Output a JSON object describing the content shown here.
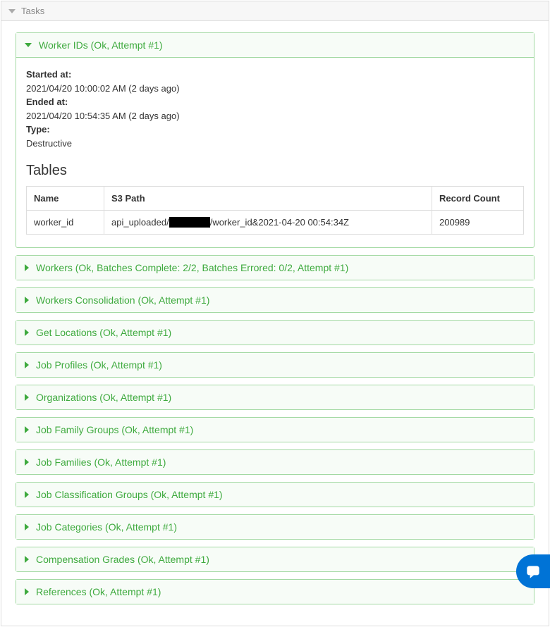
{
  "outer": {
    "title": "Tasks"
  },
  "expanded": {
    "title": "Worker IDs (Ok, Attempt #1)",
    "started_label": "Started at:",
    "started_val": "2021/04/20 10:00:02 AM (2 days ago)",
    "ended_label": "Ended at:",
    "ended_val": "2021/04/20 10:54:35 AM (2 days ago)",
    "type_label": "Type:",
    "type_val": "Destructive",
    "tables_heading": "Tables",
    "cols": {
      "name": "Name",
      "s3": "S3 Path",
      "count": "Record Count"
    },
    "row": {
      "name": "worker_id",
      "s3_pre": "api_uploaded/",
      "s3_post": "/worker_id&2021-04-20 00:54:34Z",
      "count": "200989"
    }
  },
  "tasks": [
    {
      "title": "Workers (Ok, Batches Complete: 2/2, Batches Errored: 0/2, Attempt #1)"
    },
    {
      "title": "Workers Consolidation (Ok, Attempt #1)"
    },
    {
      "title": "Get Locations (Ok, Attempt #1)"
    },
    {
      "title": "Job Profiles (Ok, Attempt #1)"
    },
    {
      "title": "Organizations (Ok, Attempt #1)"
    },
    {
      "title": "Job Family Groups (Ok, Attempt #1)"
    },
    {
      "title": "Job Families (Ok, Attempt #1)"
    },
    {
      "title": "Job Classification Groups (Ok, Attempt #1)"
    },
    {
      "title": "Job Categories (Ok, Attempt #1)"
    },
    {
      "title": "Compensation Grades (Ok, Attempt #1)"
    },
    {
      "title": "References (Ok, Attempt #1)"
    }
  ]
}
